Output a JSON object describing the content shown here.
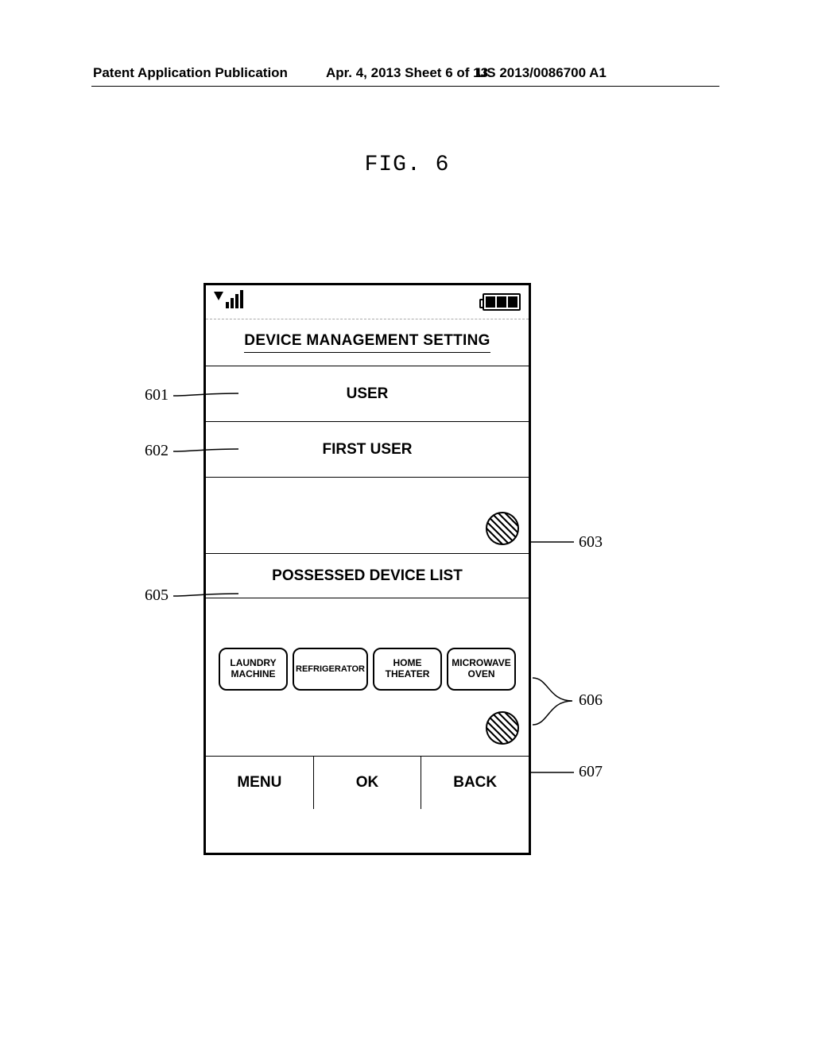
{
  "header": {
    "left": "Patent Application Publication",
    "center": "Apr. 4, 2013  Sheet 6 of 13",
    "right": "US 2013/0086700 A1"
  },
  "figure_label": "FIG. 6",
  "screen": {
    "title": "DEVICE MANAGEMENT SETTING",
    "user_heading": "USER",
    "selected_user": "FIRST USER",
    "device_list_heading": "POSSESSED DEVICE LIST",
    "devices": [
      "LAUNDRY MACHINE",
      "REFRIGERATOR",
      "HOME THEATER",
      "MICROWAVE OVEN"
    ],
    "bottom": {
      "menu": "MENU",
      "ok": "OK",
      "back": "BACK"
    }
  },
  "refs": {
    "r601": "601",
    "r602": "602",
    "r603": "603",
    "r605": "605",
    "r606": "606",
    "r607": "607"
  }
}
